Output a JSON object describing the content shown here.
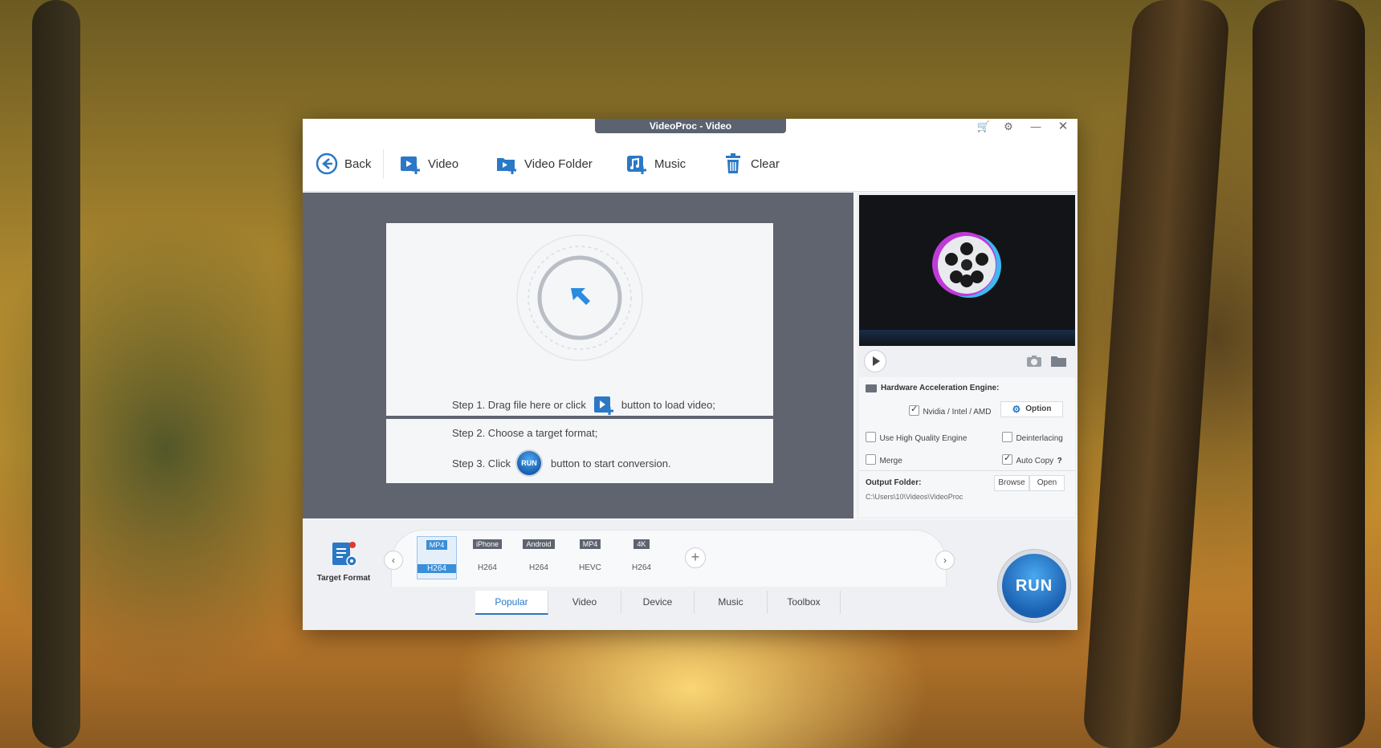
{
  "window": {
    "title": "VideoProc - Video"
  },
  "toolbar": {
    "back": "Back",
    "video": "Video",
    "video_folder": "Video Folder",
    "music": "Music",
    "clear": "Clear"
  },
  "drop": {
    "step1_before": "Step 1. Drag file here or click",
    "step1_after": "button to load video;",
    "step2": "Step 2. Choose a target format;",
    "step3_before": "Step 3. Click",
    "step3_after": "button to start conversion.",
    "run_badge": "RUN"
  },
  "settings": {
    "hw_title": "Hardware Acceleration Engine:",
    "nvidia": "Nvidia / Intel / AMD",
    "option": "Option",
    "hq_engine": "Use High Quality Engine",
    "deinterlacing": "Deinterlacing",
    "merge": "Merge",
    "auto_copy": "Auto Copy",
    "help": "?",
    "output_label": "Output Folder:",
    "output_path": "C:\\Users\\10\\Videos\\VideoProc",
    "browse": "Browse",
    "open": "Open"
  },
  "formats": {
    "target_label": "Target Format",
    "items": [
      {
        "tag": "MP4",
        "sub": "H264"
      },
      {
        "tag": "iPhone",
        "sub": "H264"
      },
      {
        "tag": "Android",
        "sub": "H264"
      },
      {
        "tag": "MP4",
        "sub": "HEVC"
      },
      {
        "tag": "4K",
        "sub": "H264"
      }
    ]
  },
  "tabs": [
    "Popular",
    "Video",
    "Device",
    "Music",
    "Toolbox"
  ],
  "run": "RUN",
  "colors": {
    "accent": "#2a78c6",
    "dark_area": "#5f646e"
  }
}
